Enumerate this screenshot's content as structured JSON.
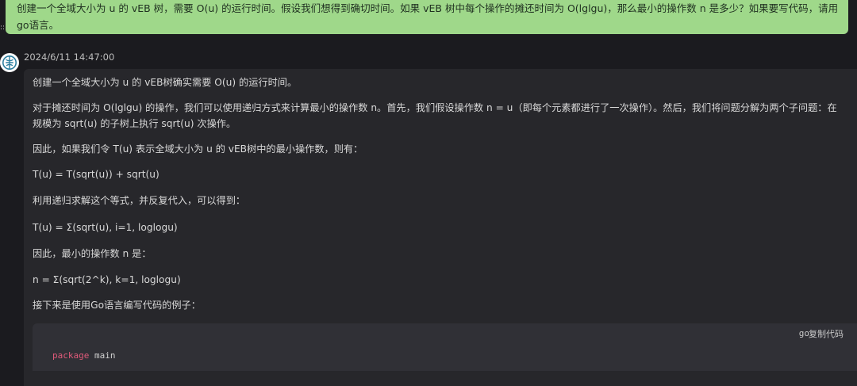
{
  "user_message": {
    "line1": "创建一个全域大小为 u 的 vEB 树，需要 O(u) 的运行时间。假设我们想得到确切时间。如果 vEB 树中每个操作的摊还时间为 O(lglgu)，那么最小的操作数 n 是多少？如果要写代码，请用",
    "line2": "go语言。"
  },
  "left_marker": "::",
  "reply": {
    "timestamp": "2024/6/11 14:47:00",
    "paragraphs": [
      "创建一个全域大小为 u 的 vEB树确实需要 O(u) 的运行时间。",
      "对于摊还时间为 O(lglgu) 的操作，我们可以使用递归方式来计算最小的操作数 n。首先，我们假设操作数 n = u（即每个元素都进行了一次操作）。然后，我们将问题分解为两个子问题：在",
      "规模为 sqrt(u) 的子树上执行 sqrt(u) 次操作。",
      "因此，如果我们令 T(u) 表示全域大小为 u 的 vEB树中的最小操作数，则有：",
      "T(u) = T(sqrt(u)) + sqrt(u)",
      "利用递归求解这个等式，并反复代入，可以得到：",
      "T(u) = Σ(sqrt(u), i=1, loglogu)",
      "因此，最小的操作数 n 是：",
      "n = Σ(sqrt(2^k), k=1, loglogu)",
      "接下来是使用Go语言编写代码的例子："
    ],
    "code": {
      "language": "go",
      "copy_label": "复制代码",
      "keyword": "package",
      "package_name": "main"
    }
  }
}
